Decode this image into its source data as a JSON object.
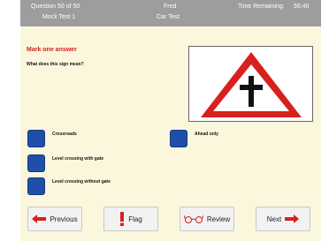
{
  "header": {
    "question_counter": "Question 50 of 50",
    "test_name": "Mock Test 1",
    "candidate_name": "Fred",
    "test_type": "Car Test",
    "time_label": "Time Remaining:",
    "time_value": "55:40"
  },
  "question": {
    "instruction": "Mark one answer",
    "text": "What does this sign mean?",
    "sign_icon": "crossroads-warning-sign-icon"
  },
  "answers": [
    {
      "label": "Crossroads"
    },
    {
      "label": "Ahead only"
    },
    {
      "label": "Level crossing with gate"
    },
    {
      "label": "Level crossing without gate"
    }
  ],
  "nav": {
    "previous_label": "Previous",
    "flag_label": "Flag",
    "review_label": "Review",
    "next_label": "Next"
  },
  "colors": {
    "header_bg": "#9d9d9d",
    "page_bg": "#fbf7dd",
    "accent_red": "#d8201c",
    "answer_box": "#1f4fa8"
  }
}
